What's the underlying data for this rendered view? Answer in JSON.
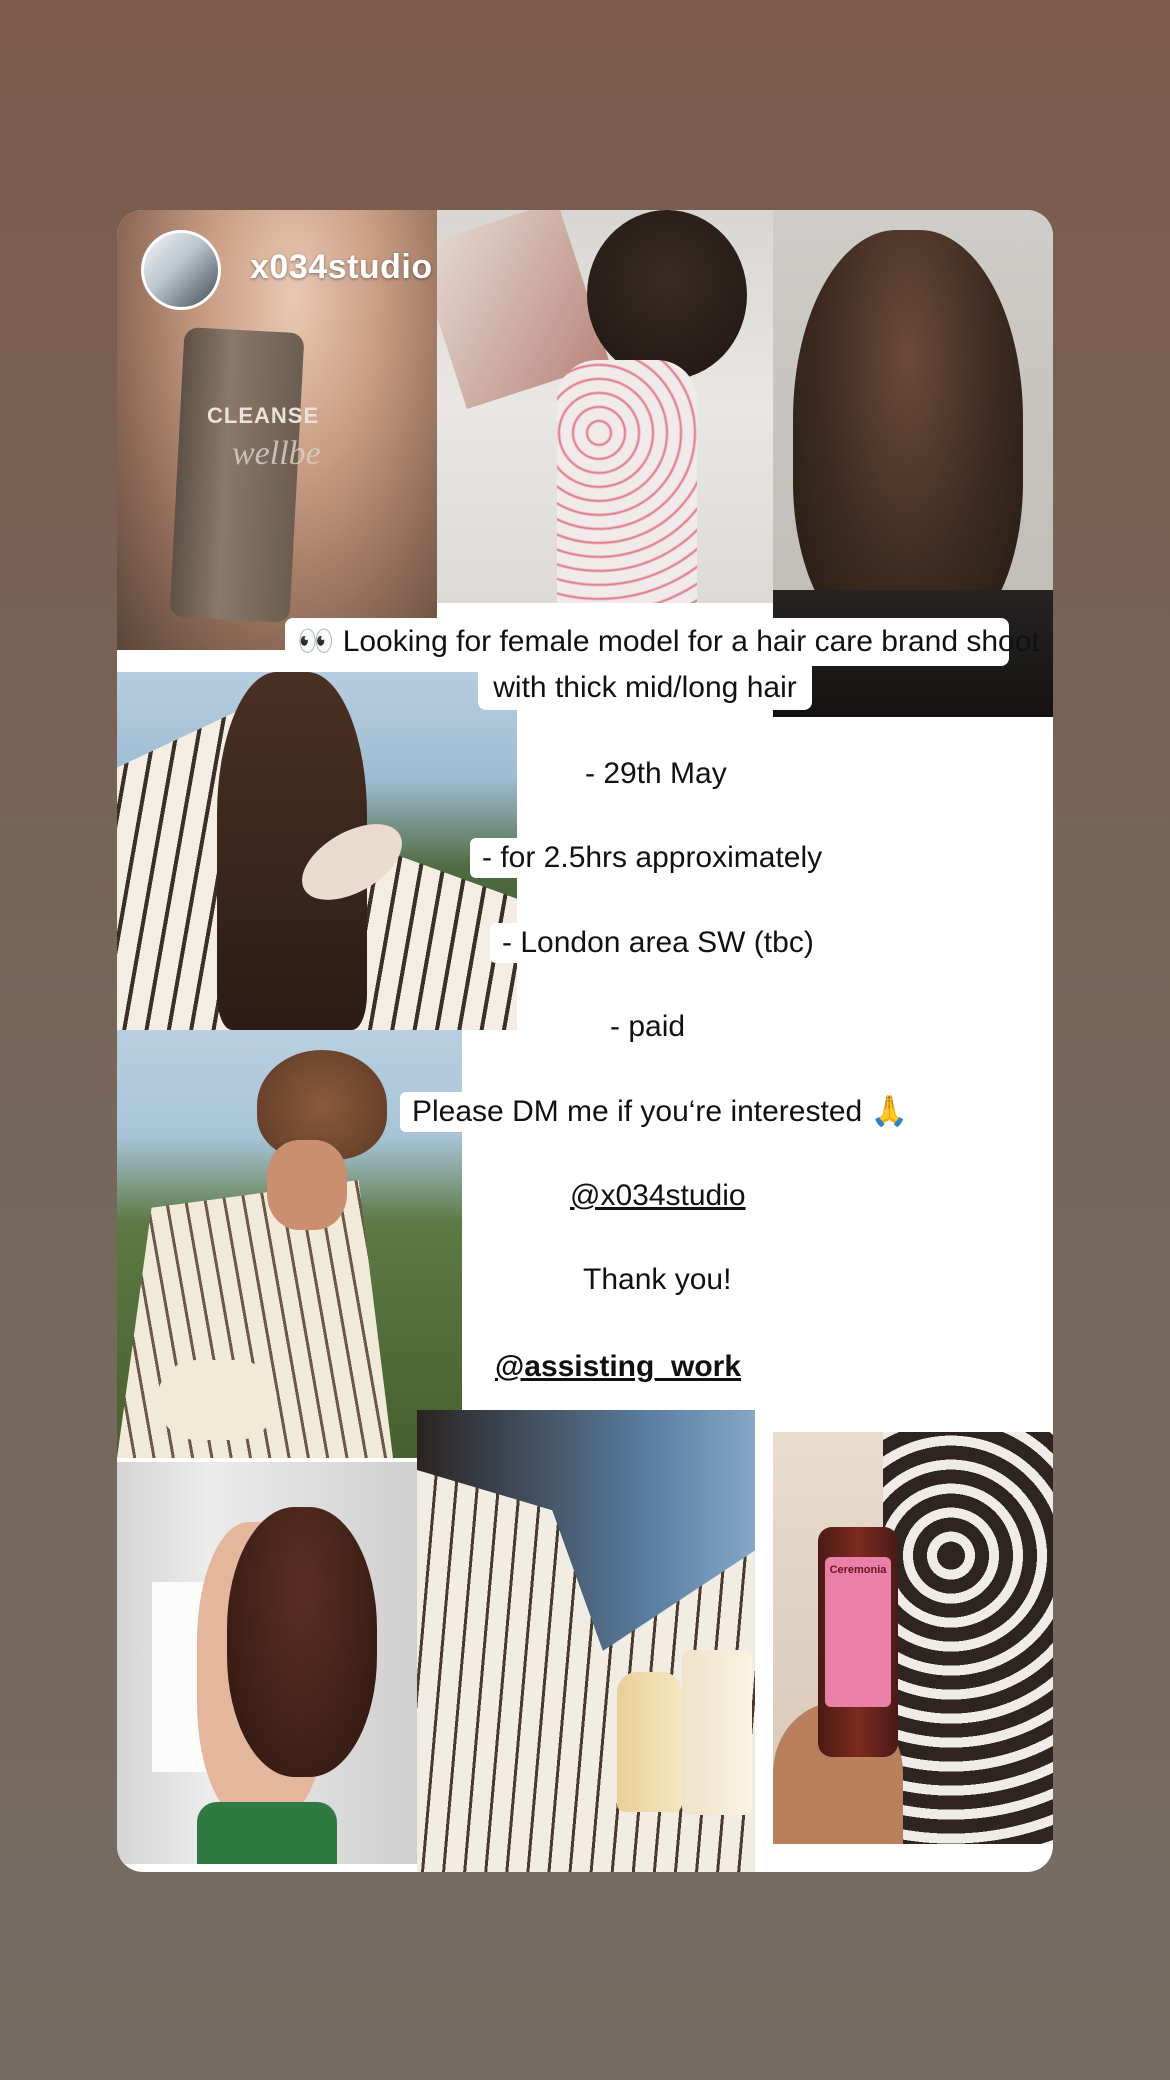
{
  "story": {
    "username": "x034studio",
    "headline_line1": "👀 Looking for female model for a hair care brand shoot",
    "headline_line2": "with thick mid/long hair",
    "details": [
      "- 29th May",
      "- for 2.5hrs approximately",
      "- London area SW (tbc)",
      "- paid"
    ],
    "cta": "Please DM me if you‘re interested 🙏",
    "mention_1": "@x034studio",
    "thanks": "Thank you!",
    "mention_2": "@assisting_work"
  },
  "photos": {
    "cleanse_label": "CLEANSE",
    "wellbe_label": "wellbe",
    "ceremonia_label": "Ceremonia"
  },
  "colors": {
    "background_top": "#7b5b4c",
    "background_bottom": "#766c63",
    "card": "#ffffff",
    "text": "#111111"
  }
}
